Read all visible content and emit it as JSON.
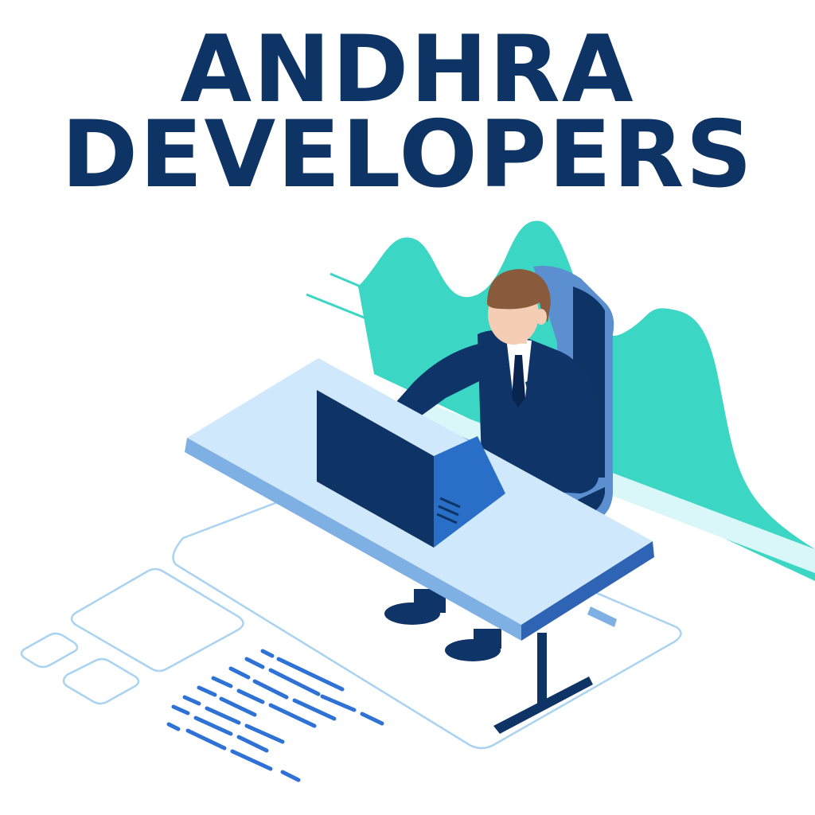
{
  "title": {
    "line1": "ANDHRA",
    "line2": "DEVELOPERS"
  },
  "colors": {
    "navy": "#0e3466",
    "teal": "#3cd6c4",
    "desk_top": "#cfe8fb",
    "desk_edge": "#4f86cc",
    "suit": "#0f3468",
    "hair": "#8a5a3c",
    "skin": "#f4cdb4",
    "chair": "#5b8fd0",
    "laptop": "#0e3466",
    "code_blue": "#2f72d6",
    "panel_outline": "#a9d3f0"
  },
  "illustration": {
    "subject": "developer-at-laptop",
    "icons": [
      "person-icon",
      "laptop-icon",
      "desk-icon",
      "chair-icon",
      "wave-chart-icon",
      "code-lines-icon"
    ]
  }
}
